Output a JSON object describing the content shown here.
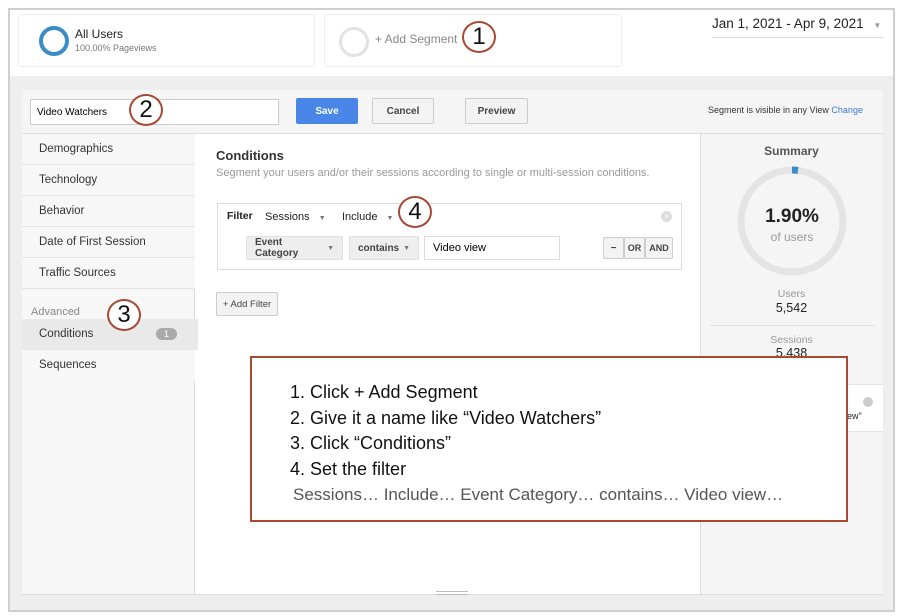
{
  "segments": {
    "all_users": {
      "title": "All Users",
      "subtitle": "100.00% Pageviews"
    },
    "add_segment": "+ Add Segment"
  },
  "date_range": "Jan 1, 2021 - Apr 9, 2021",
  "editor": {
    "name_value": "Video Watchers",
    "save": "Save",
    "cancel": "Cancel",
    "preview": "Preview",
    "visibility": "Segment is visible in any View",
    "change": "Change"
  },
  "nav": {
    "items": [
      "Demographics",
      "Technology",
      "Behavior",
      "Date of First Session",
      "Traffic Sources"
    ],
    "advanced_label": "Advanced",
    "conditions": "Conditions",
    "conditions_count": "1",
    "sequences": "Sequences"
  },
  "conditions": {
    "title": "Conditions",
    "description": "Segment your users and/or their sessions according to single or multi-session conditions.",
    "filter_label": "Filter",
    "scope": "Sessions",
    "mode": "Include",
    "dimension": "Event Category",
    "operator": "contains",
    "value": "Video view",
    "minus": "−",
    "or": "OR",
    "and": "AND",
    "add_filter": "+ Add Filter"
  },
  "summary": {
    "title": "Summary",
    "percent": "1.90%",
    "percent_label": "of users",
    "percent_value": 1.9,
    "users_label": "Users",
    "users_value": "5,542",
    "sessions_label": "Sessions",
    "sessions_value": "5,438",
    "partial_text": "iew\""
  },
  "annotations": [
    "1",
    "2",
    "3",
    "4"
  ],
  "callout": {
    "lines": [
      "1. Click + Add Segment",
      "2. Give it a name like “Video Watchers”",
      "3. Click “Conditions”",
      "4. Set the filter"
    ],
    "detail": "Sessions… Include… Event Category… contains… Video view…"
  },
  "colors": {
    "accent": "#4a86e8",
    "annotation": "#a84a32",
    "ring": "#3a8cc4"
  }
}
